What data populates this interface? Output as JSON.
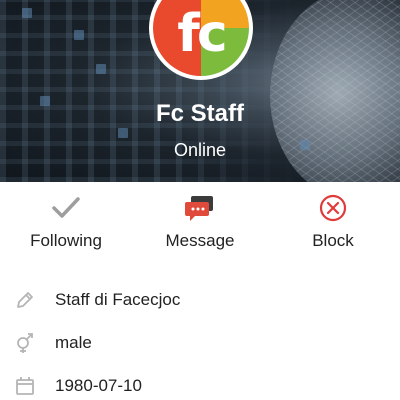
{
  "profile": {
    "logo_text": "fc",
    "name": "Fc Staff",
    "status": "Online"
  },
  "actions": [
    {
      "label": "Following",
      "icon": "check-icon"
    },
    {
      "label": "Message",
      "icon": "chat-bubble-icon"
    },
    {
      "label": "Block",
      "icon": "block-x-icon"
    }
  ],
  "details": [
    {
      "icon": "pencil-icon",
      "value": "Staff di Facecjoc"
    },
    {
      "icon": "gender-icon",
      "value": "male"
    },
    {
      "icon": "calendar-icon",
      "value": "1980-07-10"
    }
  ],
  "colors": {
    "check": "#9e9e9e",
    "message": "#e04a3a",
    "block": "#e03a3a"
  }
}
